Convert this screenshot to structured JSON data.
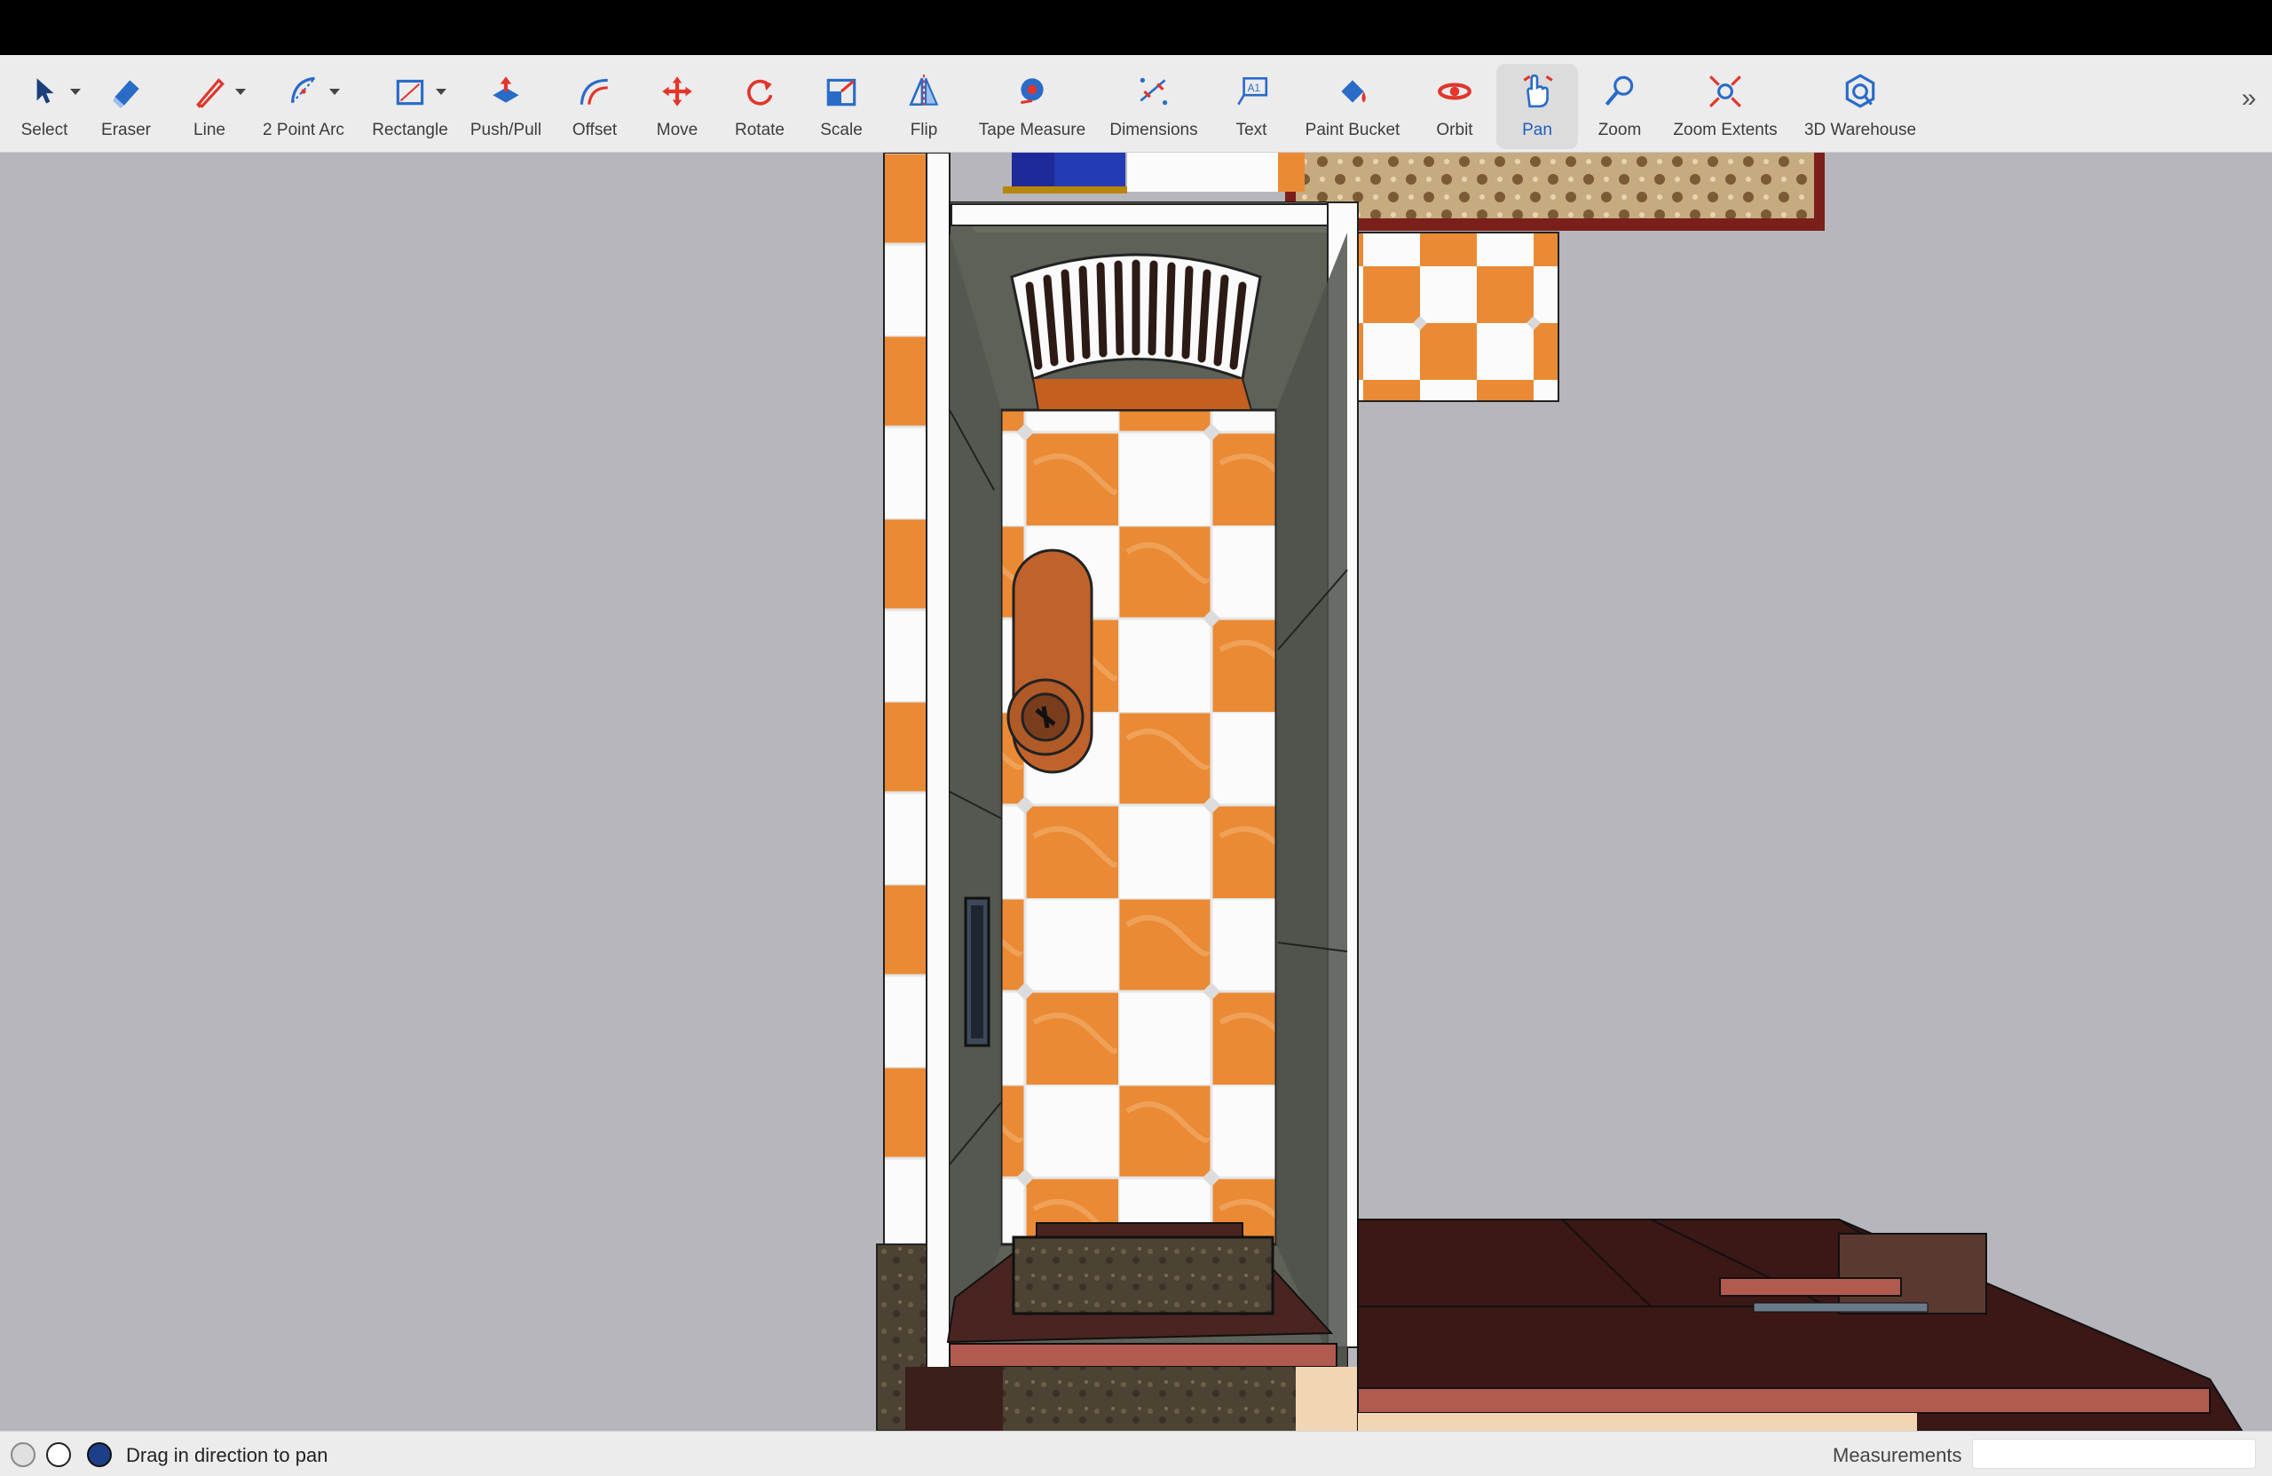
{
  "toolbar": {
    "tools": [
      {
        "label": "Select",
        "icon": "select-arrow-icon"
      },
      {
        "label": "Eraser",
        "icon": "eraser-icon"
      },
      {
        "label": "Line",
        "icon": "pencil-icon"
      },
      {
        "label": "2 Point Arc",
        "icon": "arc-icon"
      },
      {
        "label": "Rectangle",
        "icon": "rectangle-icon"
      },
      {
        "label": "Push/Pull",
        "icon": "push-pull-icon"
      },
      {
        "label": "Offset",
        "icon": "offset-icon"
      },
      {
        "label": "Move",
        "icon": "move-icon"
      },
      {
        "label": "Rotate",
        "icon": "rotate-icon"
      },
      {
        "label": "Scale",
        "icon": "scale-icon"
      },
      {
        "label": "Flip",
        "icon": "flip-icon"
      },
      {
        "label": "Tape Measure",
        "icon": "tape-measure-icon"
      },
      {
        "label": "Dimensions",
        "icon": "dimensions-icon"
      },
      {
        "label": "Text",
        "icon": "text-icon"
      },
      {
        "label": "Paint Bucket",
        "icon": "paint-bucket-icon"
      },
      {
        "label": "Orbit",
        "icon": "orbit-icon"
      },
      {
        "label": "Pan",
        "icon": "pan-hand-icon",
        "active": true
      },
      {
        "label": "Zoom",
        "icon": "zoom-icon"
      },
      {
        "label": "Zoom Extents",
        "icon": "zoom-extents-icon"
      },
      {
        "label": "3D Warehouse",
        "icon": "warehouse-icon"
      }
    ],
    "overflow_glyph": "»"
  },
  "status": {
    "message": "Drag in direction to pan",
    "measurements_label": "Measurements",
    "measurements_value": ""
  },
  "colors": {
    "accent": "#1f5fbf",
    "icon_red": "#e2352b",
    "icon_blue": "#2a6bc8",
    "tile_orange": "#ea8a35",
    "wall_green_gray": "#5e6157",
    "floor_dark": "#4a2420"
  }
}
